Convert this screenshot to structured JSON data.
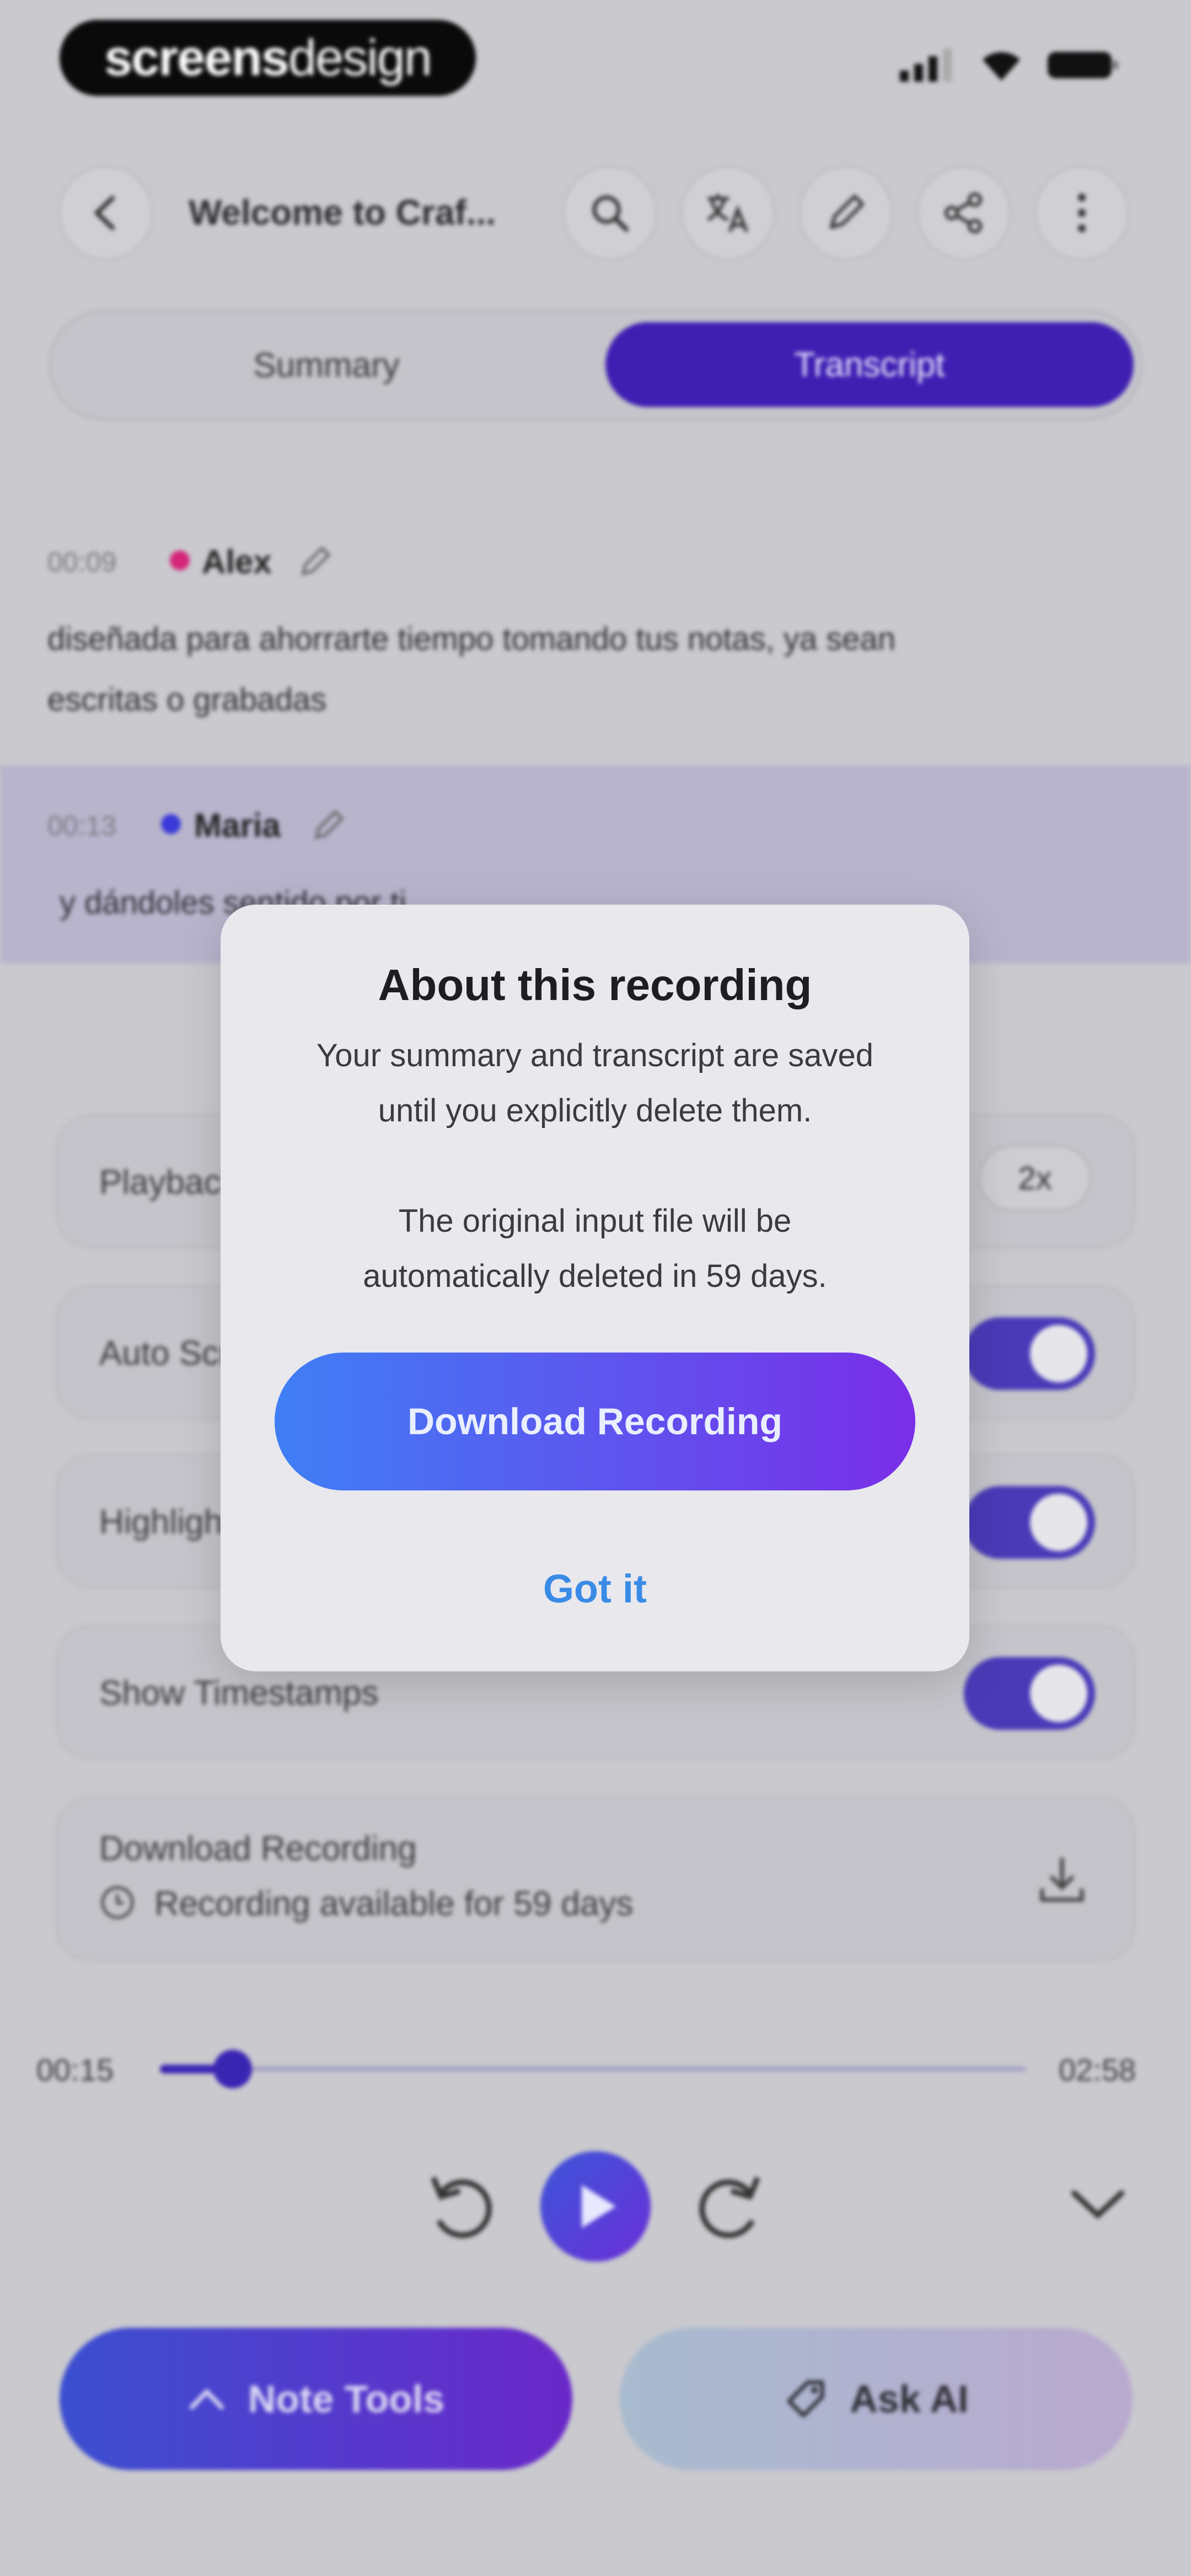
{
  "brand": {
    "bold": "screens",
    "light": "design"
  },
  "header": {
    "title": "Welcome to Craf..."
  },
  "tabs": {
    "summary": "Summary",
    "transcript": "Transcript"
  },
  "transcript": [
    {
      "time": "00:09",
      "speaker": "Alex",
      "color": "#d5267a",
      "text_line1": " diseñada para ahorrarte tiempo tomando tus notas, ya sean",
      "text_line2": "escritas o grabadas"
    },
    {
      "time": "00:13",
      "speaker": "Maria",
      "color": "#3a3ad8",
      "text_line1": "y dándoles sentido por ti"
    }
  ],
  "settings": {
    "playback_label": "Playback Speed",
    "playback_value": "2x",
    "auto_scroll_label": "Auto Scroll",
    "highlight_label": "Highlight",
    "timestamps_label": "Show Timestamps",
    "download_title": "Download Recording",
    "download_sub": "Recording available for 59 days"
  },
  "player": {
    "current": "00:15",
    "total": "02:58",
    "progress_fraction": 0.084
  },
  "bottom": {
    "note_tools": "Note Tools",
    "ask_ai": "Ask AI"
  },
  "modal": {
    "title": "About this recording",
    "body_line1": "Your summary and transcript are saved",
    "body_line2": "until you explicitly delete them.",
    "body_line3": "The original input file will be",
    "body_line4": "automatically deleted in 59 days.",
    "primary": "Download Recording",
    "secondary": "Got it"
  }
}
